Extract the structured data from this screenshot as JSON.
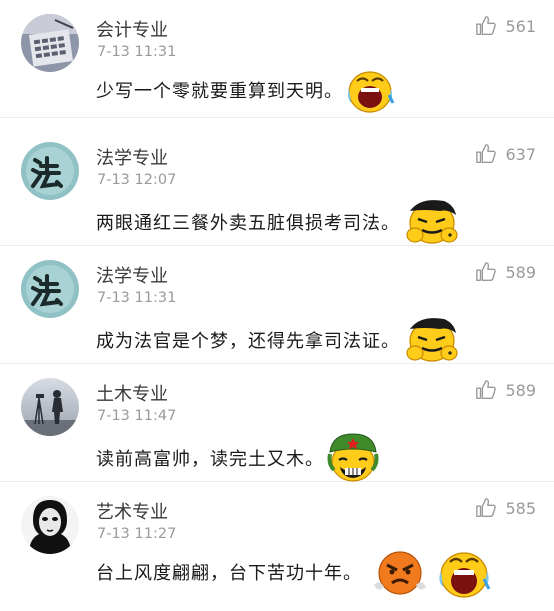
{
  "comments": [
    {
      "avatar_icon": "calculator-avatar-icon",
      "username": "会计专业",
      "time": "7-13 11:31",
      "likes": "561",
      "text": "少写一个零就要重算到天明。",
      "emojis": [
        "crying-face-icon"
      ]
    },
    {
      "avatar_icon": "fa-calligraphy-avatar-icon",
      "username": "法学专业",
      "time": "7-13 12:07",
      "likes": "637",
      "text": "两眼通红三餐外卖五脏俱损考司法。",
      "emojis": [
        "exhausted-face-icon"
      ]
    },
    {
      "avatar_icon": "fa-calligraphy-avatar-icon",
      "username": "法学专业",
      "time": "7-13 11:31",
      "likes": "589",
      "text": "成为法官是个梦，还得先拿司法证。",
      "emojis": [
        "exhausted-face-icon"
      ]
    },
    {
      "avatar_icon": "surveyor-avatar-icon",
      "username": "土木专业",
      "time": "7-13 11:47",
      "likes": "589",
      "text": "读前高富帅，读完土又木。",
      "emojis": [
        "soldier-grin-face-icon"
      ]
    },
    {
      "avatar_icon": "portrait-avatar-icon",
      "username": "艺术专业",
      "time": "7-13 11:27",
      "likes": "585",
      "text": "台上风度翩翩，台下苦功十年。",
      "emojis": [
        "angry-face-icon",
        "crying-face-icon"
      ]
    }
  ],
  "colors": {
    "username": "#3a3a3a",
    "meta": "#9a9a9a",
    "divider": "#ececec",
    "emoji_yellow": "#ffcc1a",
    "emoji_orange": "#f27a1e"
  }
}
